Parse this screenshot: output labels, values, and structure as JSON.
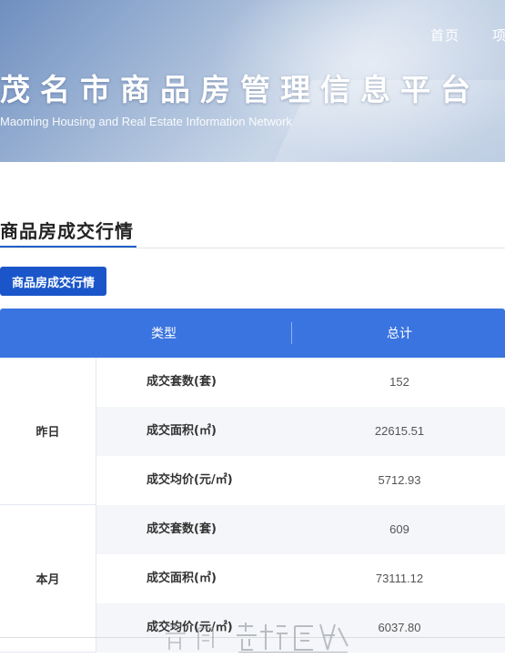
{
  "header": {
    "nav_items": [
      "首页",
      "项"
    ],
    "title": "茂名市商品房管理信息平台",
    "subtitle": "Maoming Housing and Real Estate Information Network"
  },
  "section": {
    "heading": "商品房成交行情",
    "tab_label": "商品房成交行情"
  },
  "table": {
    "columns": [
      "类型",
      "总计"
    ],
    "groups": [
      {
        "label": "昨日",
        "rows": [
          {
            "metric": "成交套数(套)",
            "value": "152"
          },
          {
            "metric": "成交面积(㎡)",
            "value": "22615.51"
          },
          {
            "metric": "成交均价(元/㎡)",
            "value": "5712.93"
          }
        ]
      },
      {
        "label": "本月",
        "rows": [
          {
            "metric": "成交套数(套)",
            "value": "609"
          },
          {
            "metric": "成交面积(㎡)",
            "value": "73111.12"
          },
          {
            "metric": "成交均价(元/㎡)",
            "value": "6037.80"
          }
        ]
      }
    ]
  },
  "watermark": {
    "text": "茂名在线",
    "url_text": "WWW.GDMM.COM"
  },
  "colors": {
    "accent": "#1a56c9",
    "table_header": "#3a74e0",
    "row_alt": "#f4f6f9"
  }
}
